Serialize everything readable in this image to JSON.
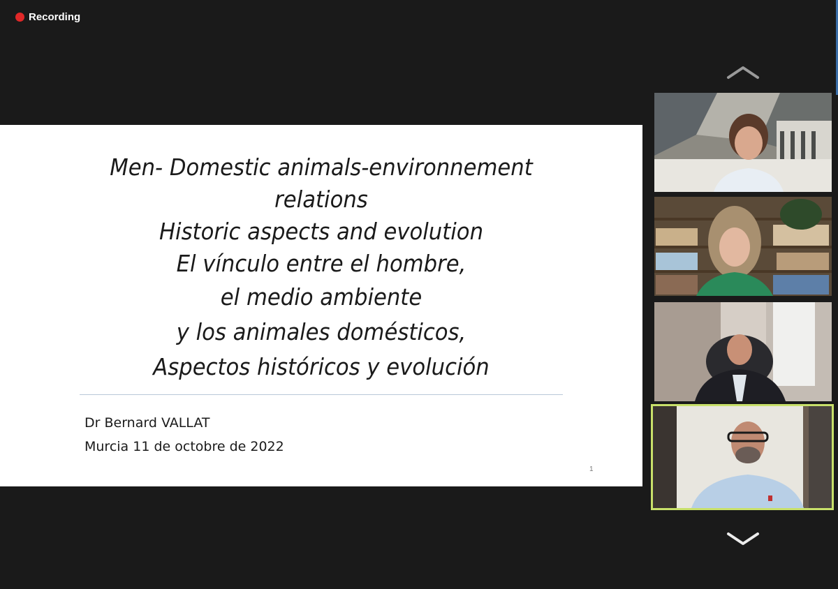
{
  "recording": {
    "label": "Recording",
    "color": "#e02828"
  },
  "slide": {
    "title_lines": [
      "Men- Domestic animals-environnement",
      "relations",
      "Historic aspects and evolution",
      "El vínculo entre el hombre,",
      "el medio ambiente",
      "y los animales domésticos,",
      "Aspectos históricos y evolución"
    ],
    "author": "Dr Bernard VALLAT",
    "date": "Murcia 11 de octobre de 2022",
    "page_number": "1"
  },
  "gallery": {
    "nav_up_icon": "chevron-up-icon",
    "nav_down_icon": "chevron-down-icon",
    "active_speaker_border": "#c8e06a",
    "participants": [
      {
        "tile": 1,
        "active": false
      },
      {
        "tile": 2,
        "active": false
      },
      {
        "tile": 3,
        "active": false
      },
      {
        "tile": 4,
        "active": true
      }
    ]
  }
}
